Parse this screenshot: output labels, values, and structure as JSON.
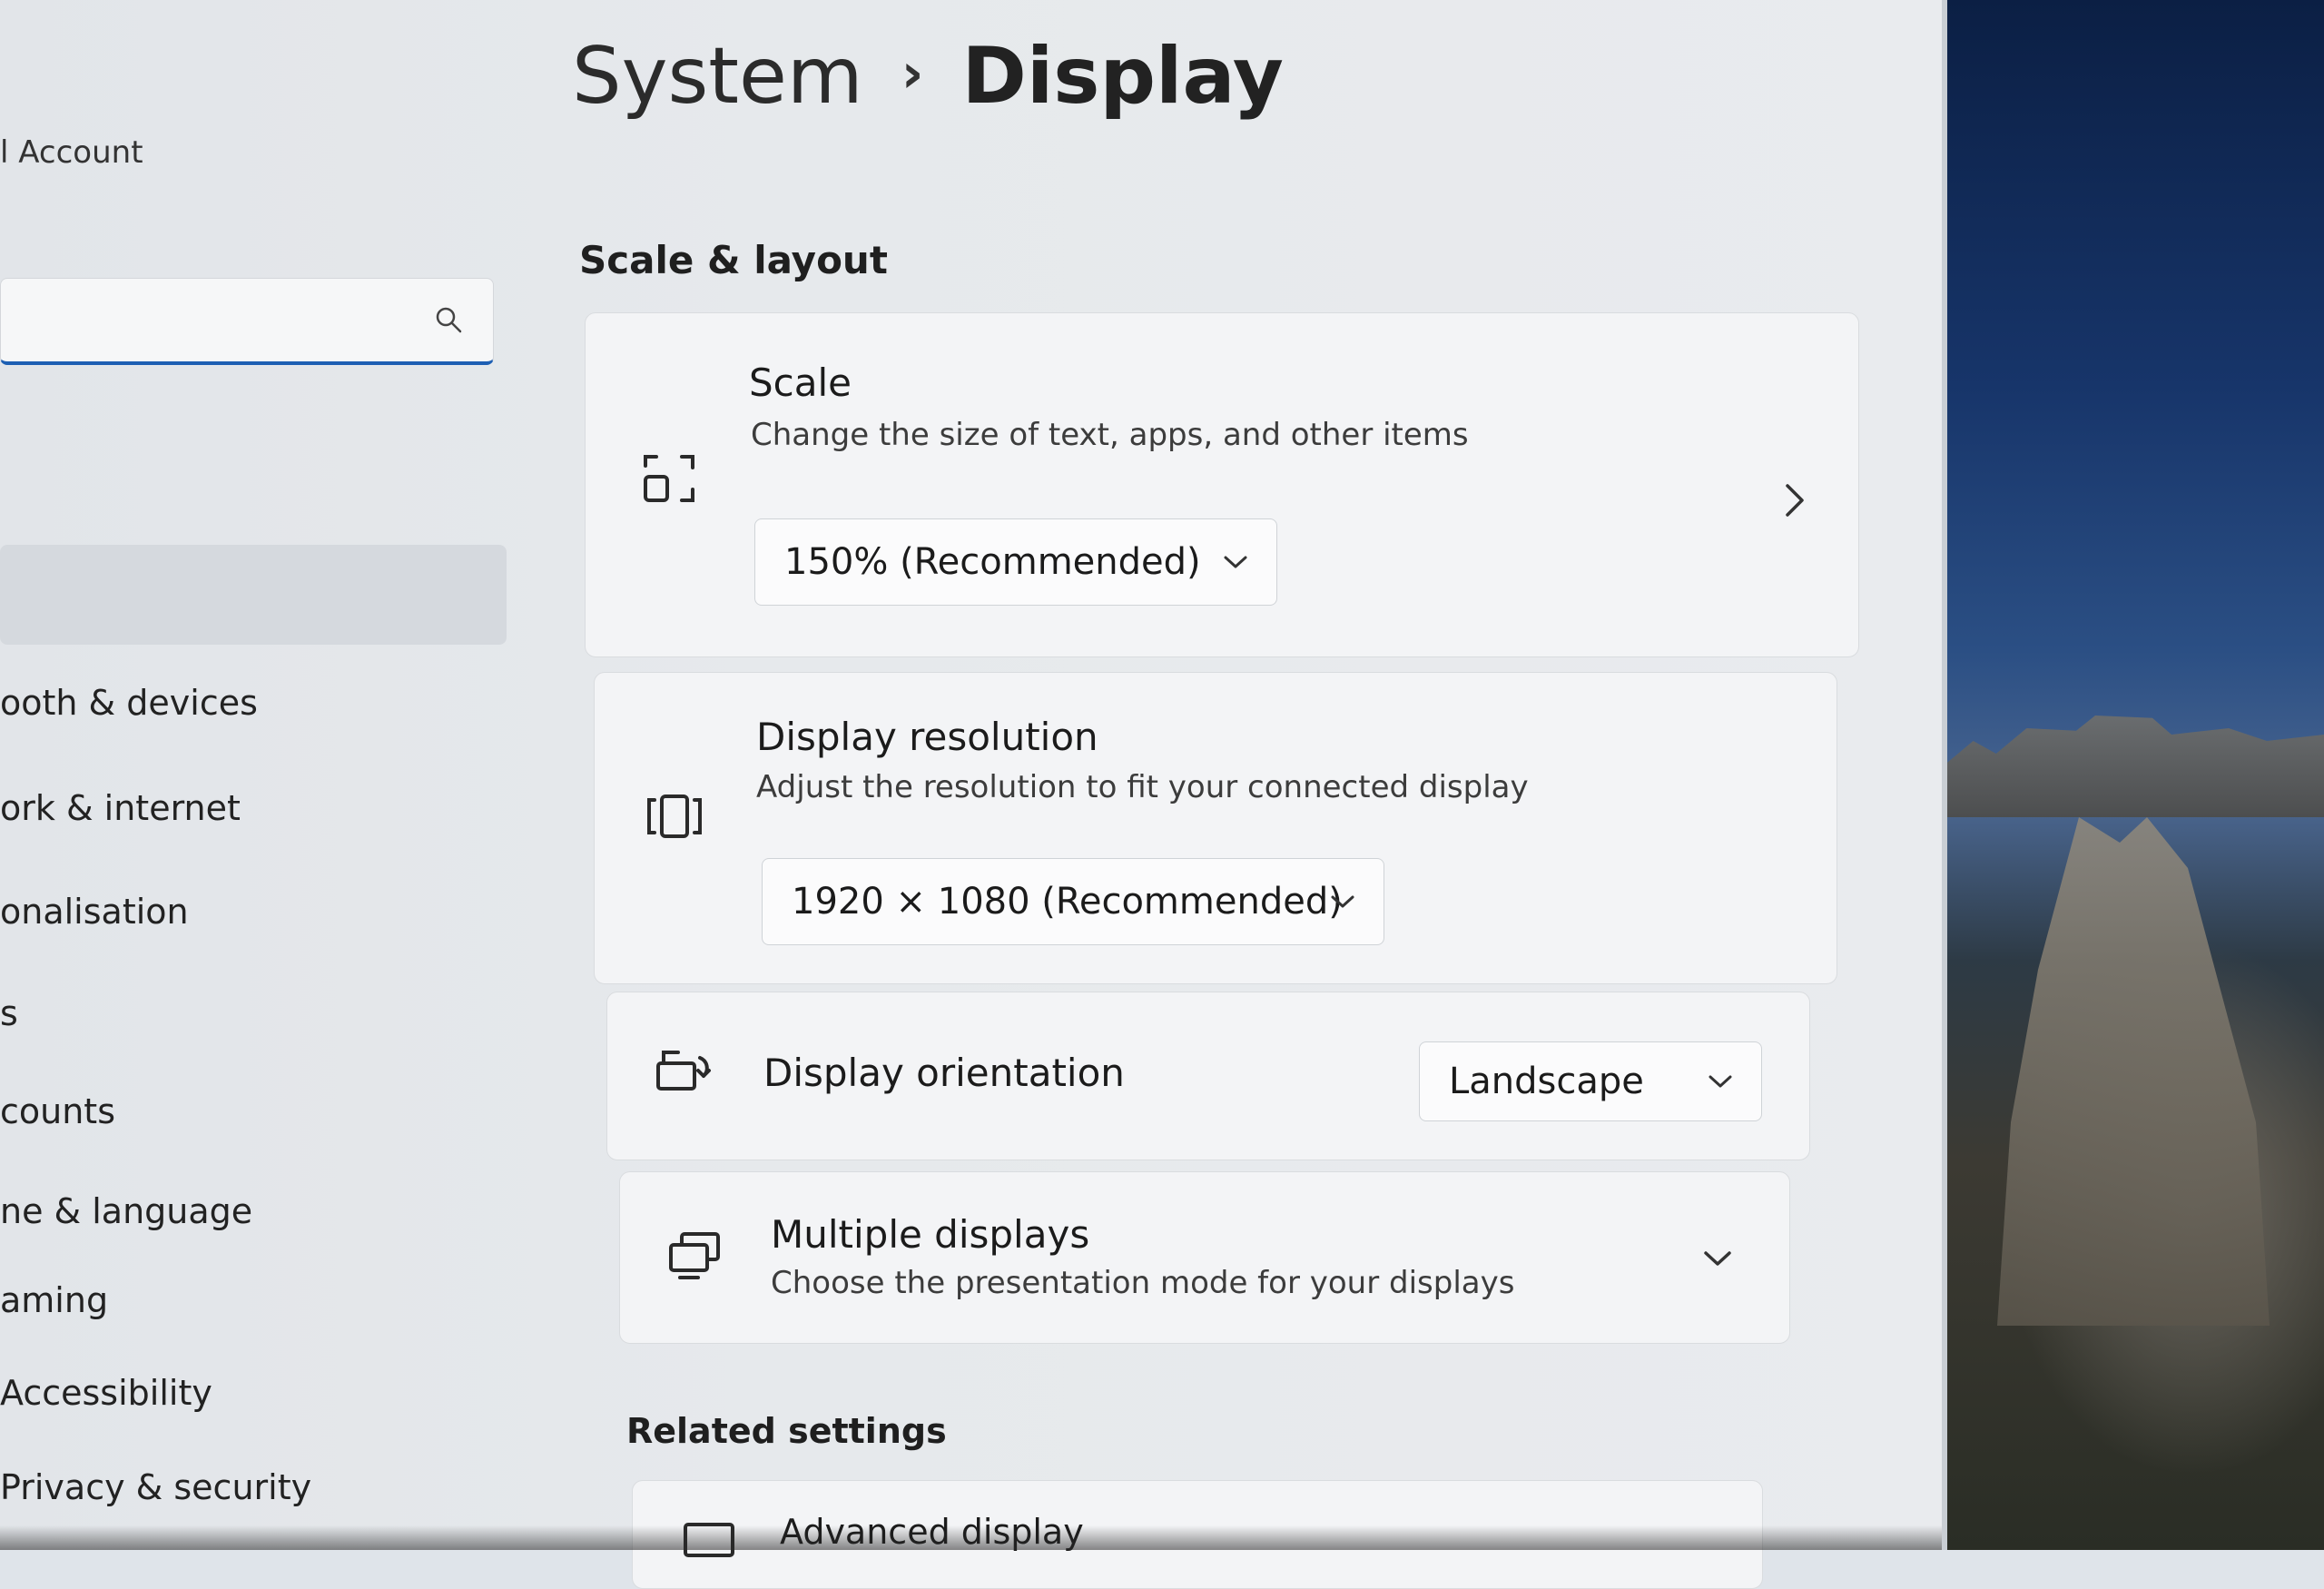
{
  "sidebar": {
    "account_label": "l Account",
    "search": {
      "placeholder": ""
    },
    "items": [
      {
        "label": ""
      },
      {
        "label": "ooth & devices"
      },
      {
        "label": "ork & internet"
      },
      {
        "label": "onalisation"
      },
      {
        "label": "s"
      },
      {
        "label": "counts"
      },
      {
        "label": "ne & language"
      },
      {
        "label": "aming"
      },
      {
        "label": "Accessibility"
      },
      {
        "label": "Privacy & security"
      }
    ]
  },
  "header": {
    "breadcrumb_parent": "System",
    "breadcrumb_separator": "›",
    "page_title": "Display"
  },
  "main": {
    "scale_layout": {
      "title": "Scale & layout",
      "scale": {
        "title": "Scale",
        "subtitle": "Change the size of text, apps, and other items",
        "value": "150% (Recommended)"
      },
      "resolution": {
        "title": "Display resolution",
        "subtitle": "Adjust the resolution to fit your connected display",
        "value": "1920 × 1080 (Recommended)"
      },
      "orientation": {
        "title": "Display orientation",
        "value": "Landscape"
      },
      "multiple": {
        "title": "Multiple displays",
        "subtitle": "Choose the presentation mode for your displays"
      }
    },
    "related": {
      "title": "Related settings",
      "advanced": {
        "title": "Advanced display"
      }
    }
  },
  "colors": {
    "accent": "#1d5fb3",
    "card_bg": "#f3f4f6",
    "window_bg": "#e6e9ec"
  }
}
